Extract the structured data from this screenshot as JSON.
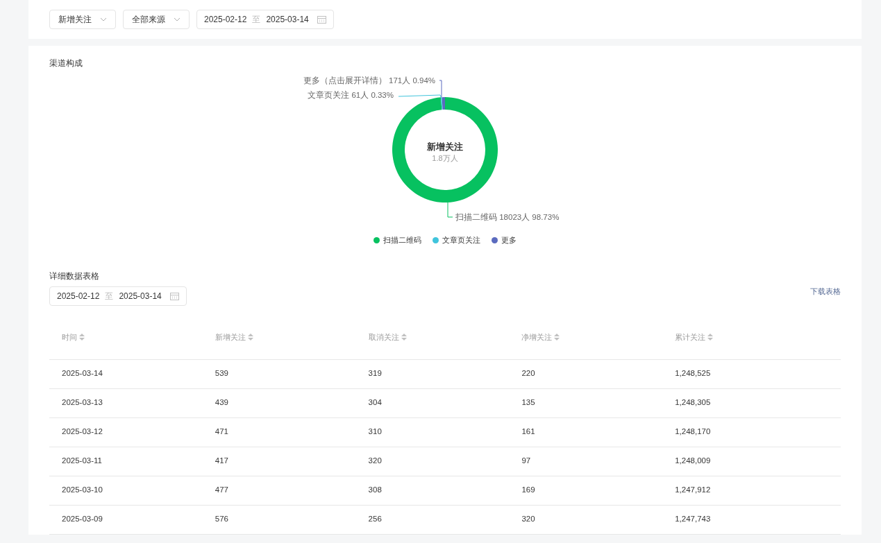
{
  "filters": {
    "metric": {
      "value": "新增关注"
    },
    "source": {
      "value": "全部来源"
    },
    "date_range": {
      "start": "2025-02-12",
      "separator": "至",
      "end": "2025-03-14"
    }
  },
  "channel_section": {
    "title": "渠道构成",
    "chart_data": {
      "type": "donut",
      "categories": [
        "扫描二维码",
        "文章页关注",
        "更多"
      ],
      "series": [
        {
          "name": "新增关注",
          "values": [
            98.73,
            0.33,
            0.94
          ]
        }
      ],
      "colors": [
        "#07c160",
        "#40c4dc",
        "#5b6bbf"
      ],
      "legend": "bottom",
      "value_labels": [
        "扫描二维码 18023人 98.73%",
        "文章页关注 61人 0.33%",
        "更多（点击展开详情） 171人 0.94%"
      ]
    },
    "center_value": "1.8万人"
  },
  "table_section": {
    "title": "详细数据表格",
    "date_range": {
      "start": "2025-02-12",
      "separator": "至",
      "end": "2025-03-14"
    },
    "download": "下载表格",
    "columns": [
      "时间",
      "新增关注",
      "取消关注",
      "净增关注",
      "累计关注"
    ],
    "rows": [
      [
        "2025-03-14",
        "539",
        "319",
        "220",
        "1,248,525"
      ],
      [
        "2025-03-13",
        "439",
        "304",
        "135",
        "1,248,305"
      ],
      [
        "2025-03-12",
        "471",
        "310",
        "161",
        "1,248,170"
      ],
      [
        "2025-03-11",
        "417",
        "320",
        "97",
        "1,248,009"
      ],
      [
        "2025-03-10",
        "477",
        "308",
        "169",
        "1,247,912"
      ],
      [
        "2025-03-09",
        "576",
        "256",
        "320",
        "1,247,743"
      ]
    ]
  }
}
